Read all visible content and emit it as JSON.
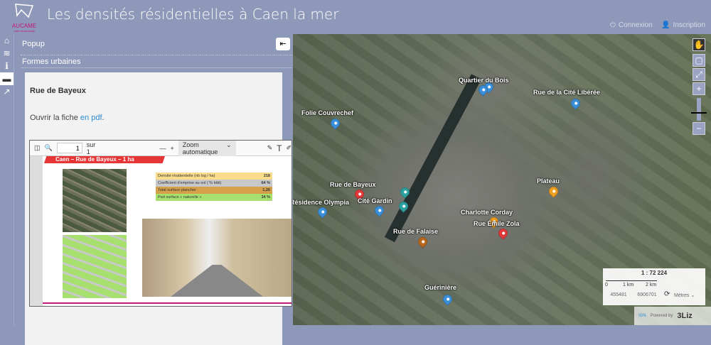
{
  "header": {
    "title": "Les densités résidentielles à Caen la mer",
    "logo_text": "AUCAME",
    "logo_sub": "Caen Normandie",
    "connexion": "Connexion",
    "inscription": "Inscription"
  },
  "rail": {
    "icons": [
      "home-icon",
      "layers-icon",
      "info-icon",
      "popup-icon",
      "share-icon"
    ]
  },
  "panel": {
    "title": "Popup",
    "section": "Formes urbaines",
    "feature_title": "Rue de Bayeux",
    "text": "Ouvrir la fiche ",
    "link": "en pdf",
    "text_end": "."
  },
  "pdf": {
    "page": "1",
    "of": "sur 1",
    "zoom": "Zoom automatique",
    "banner": "Caen – Rue de Bayeux – 1 ha",
    "rows": [
      {
        "label": "Densité résidentielle (nb log / ha)",
        "value": "218",
        "color": "#f9dc8c"
      },
      {
        "label": "Coefficient d'emprise au sol ( % bâti)",
        "value": "64 %",
        "color": "#c8c8c8"
      },
      {
        "label": "Total surface plancher",
        "value": "1,26",
        "color": "#d4a04a"
      },
      {
        "label": "Part surface « naturelle »",
        "value": "34 %",
        "color": "#a8e070"
      }
    ]
  },
  "map": {
    "places": [
      {
        "name": "Quartier du Bois",
        "color": "#3b8fd8"
      },
      {
        "name": "Rue de la Cité Libérée",
        "color": "#3b8fd8"
      },
      {
        "name": "Folie Couvrechef",
        "color": "#3b8fd8"
      },
      {
        "name": "Plateau",
        "color": "#f0a020"
      },
      {
        "name": "Rue de Bayeux",
        "color": "#e03a3a"
      },
      {
        "name": "Résidence Olympia",
        "color": "#3b8fd8"
      },
      {
        "name": "Cité Gardin",
        "color": "#2fa0a0"
      },
      {
        "name": "Charlotte Corday",
        "color": "#f0a020"
      },
      {
        "name": "Rue Émile Zola",
        "color": "#e03a3a"
      },
      {
        "name": "Rue de Falaise",
        "color": "#b8681e"
      },
      {
        "name": "Guérinière",
        "color": "#3b8fd8"
      }
    ],
    "scale": "1 : 72 224",
    "scale_ticks": [
      "0",
      "1 km",
      "2 km"
    ],
    "x": "455481",
    "y": "6906701",
    "units": "Mètres",
    "attrib_ign": "IGN",
    "attrib_powered": "Powered by",
    "attrib_brand": "3Liz"
  }
}
